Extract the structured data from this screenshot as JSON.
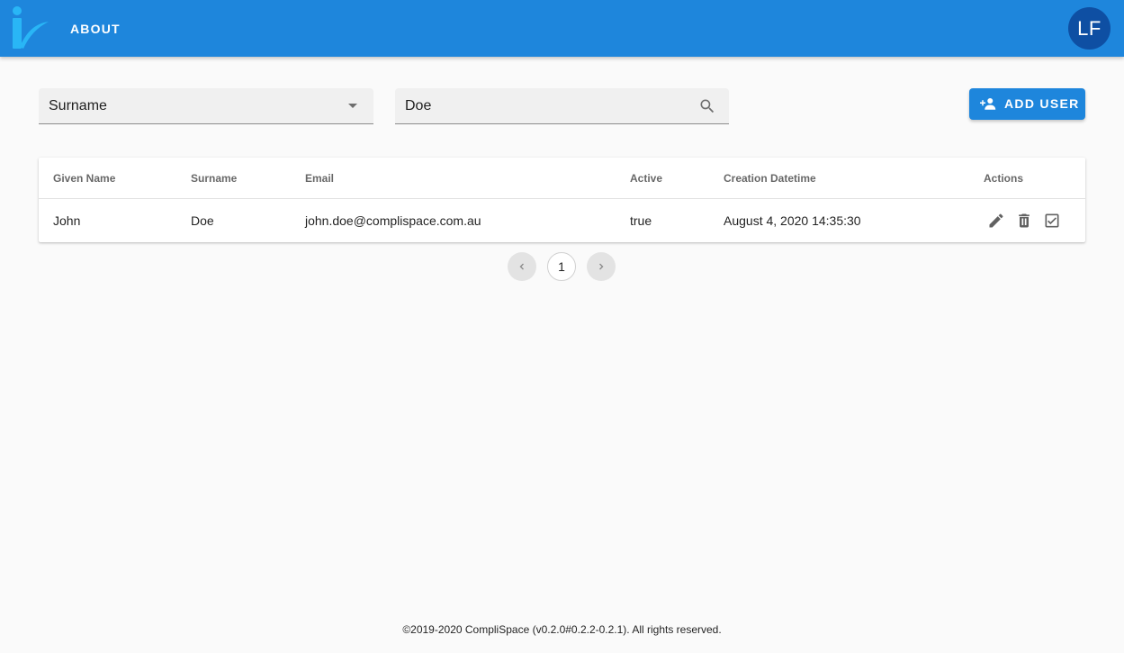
{
  "header": {
    "nav_about": "ABOUT",
    "avatar_initials": "LF",
    "bar_color": "#1e86dc"
  },
  "filters": {
    "field_select_value": "Surname",
    "search_value": "Doe",
    "search_placeholder": ""
  },
  "toolbar": {
    "add_user_label": "ADD USER",
    "add_user_icon": "person-add-icon"
  },
  "table": {
    "columns": [
      "Given Name",
      "Surname",
      "Email",
      "Active",
      "Creation Datetime",
      "Actions"
    ],
    "rows": [
      {
        "given_name": "John",
        "surname": "Doe",
        "email": "john.doe@complispace.com.au",
        "active": "true",
        "creation_datetime": "August 4, 2020 14:35:30",
        "actions": [
          "edit-icon",
          "delete-icon",
          "activate-checkbox-icon"
        ]
      }
    ]
  },
  "pagination": {
    "current_page": "1"
  },
  "footer": {
    "text": "©2019-2020 CompliSpace (v0.2.0#0.2.2-0.2.1). All rights reserved."
  }
}
